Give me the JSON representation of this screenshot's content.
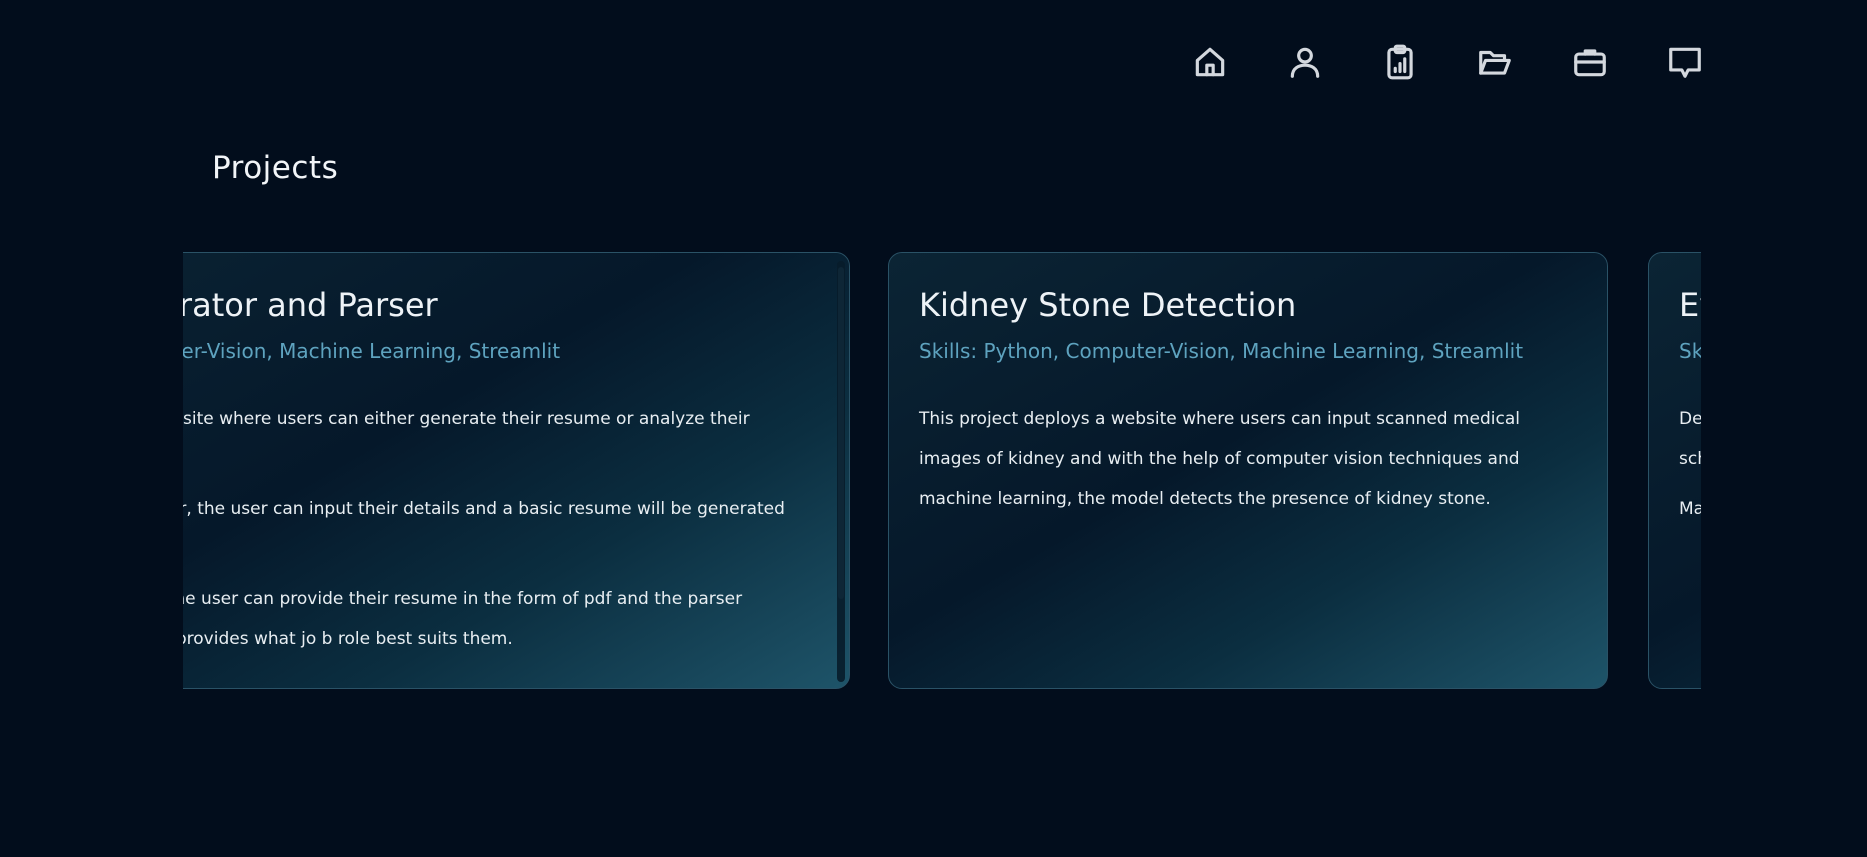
{
  "nav": {
    "items": [
      {
        "icon": "home-icon"
      },
      {
        "icon": "user-icon"
      },
      {
        "icon": "clipboard-chart-icon"
      },
      {
        "icon": "folder-open-icon"
      },
      {
        "icon": "briefcase-icon"
      },
      {
        "icon": "chat-icon"
      }
    ]
  },
  "section": {
    "title": "Projects"
  },
  "cards": [
    {
      "title": "Resume Generator and Parser",
      "skills": "Skills: Python, Computer-Vision, Machine Learning, Streamlit",
      "paragraphs": [
        "This project deploys a website where users can either generate their resume or analyze their existing resumes.",
        "With the resume generator, the user can input their details and a basic resume will be generated with the given details.",
        "With the resume parser, the user can provide their resume in the form of pdf and the parser analyzes the resume and provides what jo b role best suits them."
      ]
    },
    {
      "title": "Kidney Stone Detection",
      "skills": "Skills: Python, Computer-Vision, Machine Learning, Streamlit",
      "paragraphs": [
        "This project deploys a website where users can input scanned medical images of kidney and with the help of computer vision techniques and machine learning, the model detects the presence of kidney stone."
      ]
    },
    {
      "title": "Ev",
      "skills": "Sk",
      "paragraphs": [
        "Dev sch",
        "Ma"
      ]
    }
  ],
  "colors": {
    "background": "#020d1c",
    "accent": "#5ea3bf",
    "card_border": "#2a5266"
  }
}
